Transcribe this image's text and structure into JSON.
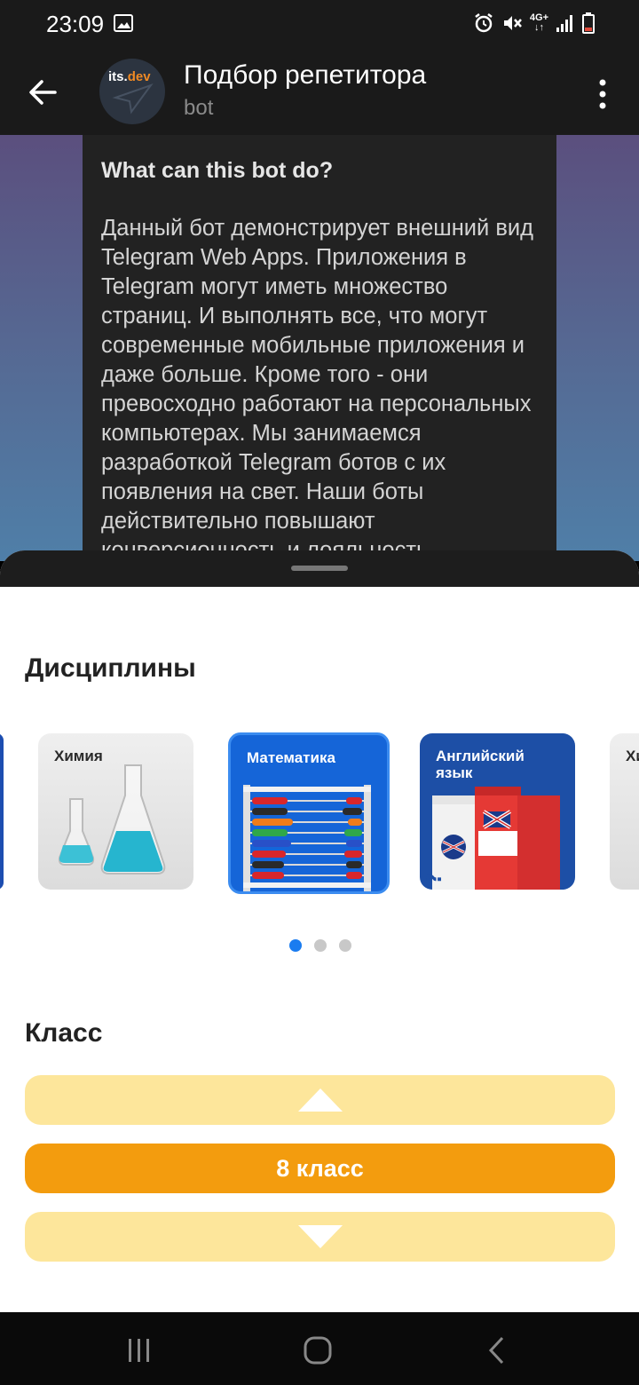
{
  "status_bar": {
    "time": "23:09",
    "network": "4G+",
    "icons": [
      "image-icon",
      "alarm-icon",
      "mute-icon",
      "network-icon",
      "signal-icon",
      "battery-icon"
    ]
  },
  "header": {
    "title": "Подбор репетитора",
    "subtitle": "bot",
    "avatar_logo": "its.dev"
  },
  "chat": {
    "question": "What can this bot do?",
    "description": "Данный бот демонстрирует внешний вид Telegram Web Apps. Приложения в Telegram могут иметь множество страниц. И выполнять все, что могут современные мобильные приложения и даже больше. Кроме того - они превосходно работают на персональных компьютерах. Мы занимаемся разработкой Telegram ботов с их появления на свет. Наши боты действительно повышают конверсионность и лояльность"
  },
  "disciplines": {
    "heading": "Дисциплины",
    "items": [
      {
        "label": "Химия"
      },
      {
        "label": "Математика",
        "selected": true
      },
      {
        "label": "Английский язык"
      }
    ],
    "page_count": 3,
    "active_page": 1
  },
  "grade": {
    "heading": "Класс",
    "value": "8 класс"
  },
  "colors": {
    "accent": "#f39c0e",
    "button_light": "#fde69b",
    "selected_border": "#1a7cf0"
  }
}
